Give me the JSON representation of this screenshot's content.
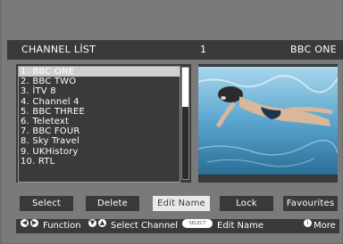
{
  "header": {
    "title": "CHANNEL LİST",
    "channel_number": "1",
    "channel_name": "BBC ONE"
  },
  "channels": [
    "1. BBC ONE",
    "2. BBC TWO",
    "3. İTV 8",
    "4. Channel 4",
    "5. BBC THREE",
    "6. Teletext",
    "7. BBC FOUR",
    "8. Sky Travel",
    "9. UKHistory",
    "10. RTL"
  ],
  "selected_index": 0,
  "buttons": {
    "select": "Select",
    "delete": "Delete",
    "edit_name": "Edit Name",
    "lock": "Lock",
    "favourites": "Favourites"
  },
  "help": {
    "function": "Function",
    "select_channel": "Select Channel",
    "select_key": "SELECT",
    "edit_name": "Edit Name",
    "more": "More"
  },
  "icons": {
    "left_right": "left-right-arrows-icon",
    "up_down": "up-down-arrows-icon",
    "info": "info-icon"
  },
  "colors": {
    "panel": "#3a3a3a",
    "background": "#7a7a7a",
    "selected_row": "#cfcfcf",
    "active_button": "#e9e9e9",
    "water": "#5fa8cf"
  }
}
